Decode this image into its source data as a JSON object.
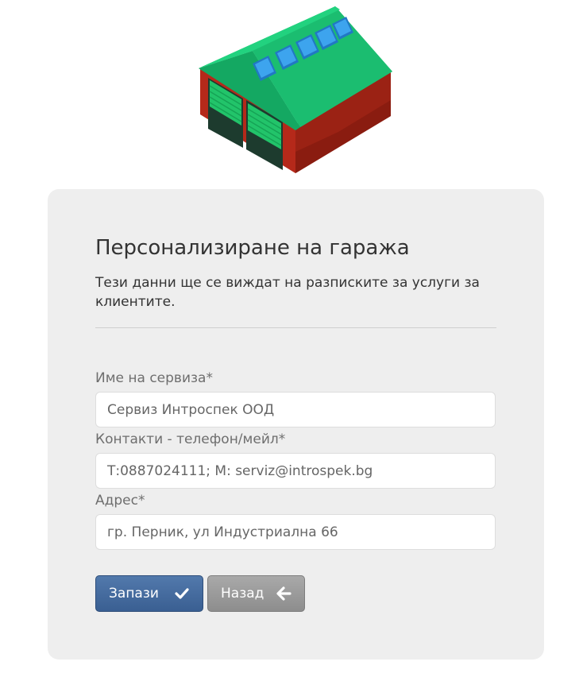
{
  "logo": {
    "icon": "garage-icon",
    "colors": {
      "roof": "#1fc777",
      "roof_dark": "#14a862",
      "walls": "#b5291a",
      "windows": "#3da4ee",
      "doors": "#22c46a"
    }
  },
  "card": {
    "title": "Персонализиране на гаража",
    "subtitle": "Тези данни ще се виждат на разписките за услуги за клиентите."
  },
  "form": {
    "service_name": {
      "label": "Име на сервиза*",
      "value": "Сервиз Интроспек ООД"
    },
    "contacts": {
      "label": "Контакти - телефон/мейл*",
      "value": "Т:0887024111; М: serviz@introspek.bg"
    },
    "address": {
      "label": "Адрес*",
      "value": "гр. Перник, ул Индустриална 66"
    }
  },
  "buttons": {
    "save": {
      "label": "Запази",
      "icon": "check-icon",
      "color": "#4a6fa2"
    },
    "back": {
      "label": "Назад",
      "icon": "arrow-left-icon",
      "color": "#9b9b9b"
    }
  }
}
